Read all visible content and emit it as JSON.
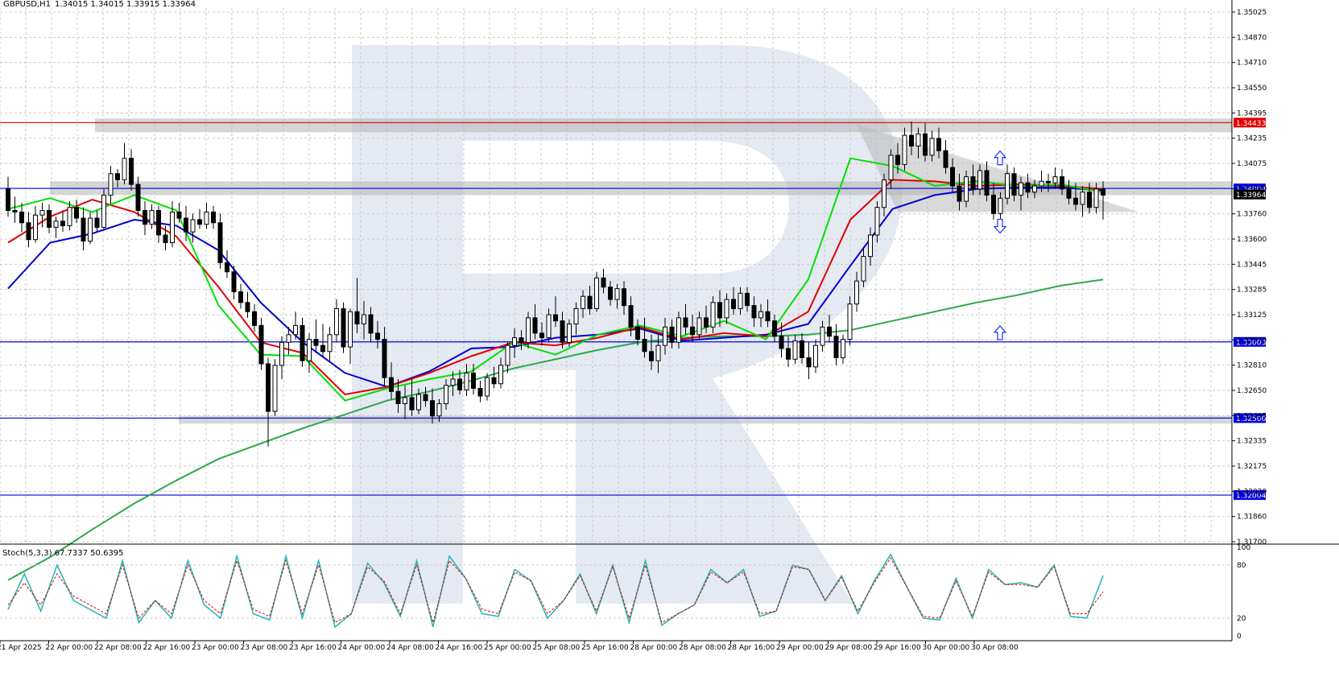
{
  "header": {
    "symbol": "GBPUSD,H1",
    "ohlc": "1.34015 1.34015 1.33915 1.33964"
  },
  "watermark": {
    "letter": "R",
    "color": "#e5e9f2"
  },
  "colors": {
    "grid": "#c8c8c8",
    "ma_fast": "#00e000",
    "ma_mid": "#e00000",
    "ma_slow": "#0000d0",
    "ma_long": "#2aa84a",
    "resistance": "#e00000",
    "support": "#0000e0",
    "zone": "#b4b4b4",
    "arrow": "#2a3fe8",
    "stoch_main": "#22b5b5",
    "stoch_signal": "#e00000",
    "bull_candle": "#ffffff",
    "bear_candle": "#000000"
  },
  "chart_data": {
    "type": "candlestick",
    "instrument": "GBPUSD",
    "timeframe": "H1",
    "ylim": [
      1.317,
      1.3518
    ],
    "price_ticks": [
      "1.35025",
      "1.34870",
      "1.34710",
      "1.34550",
      "1.34395",
      "1.34235",
      "1.34075",
      "1.33920",
      "1.33760",
      "1.33600",
      "1.33445",
      "1.33285",
      "1.33125",
      "1.32970",
      "1.32810",
      "1.32650",
      "1.32495",
      "1.32335",
      "1.32175",
      "1.32020",
      "1.31860",
      "1.31700"
    ],
    "time_ticks": [
      "21 Apr 2025",
      "22 Apr 00:00",
      "22 Apr 08:00",
      "22 Apr 16:00",
      "23 Apr 00:00",
      "23 Apr 08:00",
      "23 Apr 16:00",
      "24 Apr 00:00",
      "24 Apr 08:00",
      "24 Apr 16:00",
      "25 Apr 00:00",
      "25 Apr 08:00",
      "25 Apr 16:00",
      "28 Apr 00:00",
      "28 Apr 08:00",
      "28 Apr 16:00",
      "29 Apr 00:00",
      "29 Apr 08:00",
      "29 Apr 16:00",
      "30 Apr 00:00",
      "30 Apr 08:00"
    ],
    "horizontal_levels": [
      {
        "label": "1.34433",
        "value": 1.34433,
        "role": "resistance"
      },
      {
        "label": "1.34004",
        "value": 1.34004,
        "role": "support"
      },
      {
        "label": "1.33003",
        "value": 1.33003,
        "role": "support"
      },
      {
        "label": "1.32506",
        "value": 1.32506,
        "role": "support"
      },
      {
        "label": "1.32004",
        "value": 1.32004,
        "role": "support"
      }
    ],
    "current_price": {
      "label": "1.33964",
      "value": 1.33964
    },
    "zones": [
      {
        "from": "22 Apr 00:00",
        "low": 1.3437,
        "high": 1.3446
      },
      {
        "from": "21 Apr 2025",
        "low": 1.3396,
        "high": 1.3405
      },
      {
        "from": "23 Apr 00:00",
        "low": 1.3247,
        "high": 1.3252
      }
    ],
    "triangle": {
      "top_start": 1.3442,
      "top_end": 1.3396,
      "bottom": 1.3385
    },
    "ma_long": [
      1.3145,
      1.316,
      1.3178,
      1.3195,
      1.321,
      1.3224,
      1.3234,
      1.3244,
      1.3253,
      1.3262,
      1.3268,
      1.3275,
      1.3283,
      1.3289,
      1.3295,
      1.33,
      1.3303,
      1.3304,
      1.3304,
      1.3305,
      1.3308,
      1.3314,
      1.332,
      1.3326,
      1.3331,
      1.3337,
      1.3341
    ],
    "series": [
      {
        "name": "MA fast",
        "values": [
          1.3387,
          1.3394,
          1.3385,
          1.3396,
          1.3386,
          1.3324,
          1.3292,
          1.3291,
          1.3262,
          1.327,
          1.3276,
          1.3281,
          1.33,
          1.3292,
          1.3305,
          1.3311,
          1.3304,
          1.3314,
          1.3302,
          1.3341,
          1.342,
          1.3415,
          1.3402,
          1.3405,
          1.3402,
          1.3403,
          1.3398
        ]
      },
      {
        "name": "MA mid",
        "values": [
          1.3365,
          1.3382,
          1.3393,
          1.3385,
          1.3369,
          1.3336,
          1.33,
          1.3293,
          1.3266,
          1.3271,
          1.328,
          1.3291,
          1.33,
          1.3298,
          1.3303,
          1.331,
          1.3302,
          1.3306,
          1.3304,
          1.332,
          1.338,
          1.3406,
          1.3405,
          1.3402,
          1.3403,
          1.3402,
          1.34
        ]
      },
      {
        "name": "MA slow",
        "values": [
          1.3335,
          1.3365,
          1.3371,
          1.338,
          1.3376,
          1.336,
          1.3326,
          1.33,
          1.328,
          1.3271,
          1.3281,
          1.3296,
          1.3297,
          1.3303,
          1.3305,
          1.3309,
          1.3301,
          1.3303,
          1.3305,
          1.3312,
          1.335,
          1.3387,
          1.3396,
          1.34,
          1.3401,
          1.3401,
          1.3399
        ]
      }
    ],
    "signal_arrows": [
      {
        "direction": "up",
        "value": 1.342
      },
      {
        "direction": "down",
        "value": 1.3376
      },
      {
        "direction": "up",
        "value": 1.3306
      }
    ],
    "indicator": {
      "label": "Stoch(5,3,3) 67.7337 50.6395",
      "ylim": [
        0,
        100
      ],
      "ticks": [
        "100",
        "80",
        "20",
        "0"
      ],
      "main": [
        30,
        70,
        28,
        80,
        40,
        30,
        20,
        85,
        15,
        40,
        20,
        85,
        35,
        20,
        90,
        25,
        18,
        90,
        20,
        85,
        10,
        25,
        82,
        60,
        22,
        85,
        10,
        90,
        65,
        25,
        22,
        75,
        62,
        20,
        40,
        70,
        25,
        80,
        15,
        85,
        12,
        25,
        35,
        75,
        60,
        75,
        22,
        28,
        80,
        75,
        40,
        68,
        25,
        62,
        92,
        55,
        20,
        18,
        65,
        20,
        75,
        58,
        60,
        55,
        80,
        22,
        20,
        68
      ],
      "signal": [
        35,
        60,
        35,
        70,
        45,
        35,
        25,
        80,
        20,
        40,
        25,
        80,
        40,
        25,
        85,
        30,
        22,
        85,
        25,
        80,
        15,
        25,
        78,
        62,
        25,
        80,
        15,
        85,
        65,
        30,
        25,
        72,
        62,
        25,
        40,
        68,
        28,
        78,
        20,
        80,
        15,
        25,
        35,
        72,
        60,
        72,
        25,
        28,
        78,
        75,
        40,
        66,
        28,
        60,
        88,
        55,
        22,
        20,
        62,
        22,
        72,
        58,
        58,
        55,
        78,
        25,
        25,
        50
      ]
    },
    "candles": [
      [
        1.34,
        1.3408,
        1.3382,
        1.3386
      ],
      [
        1.3386,
        1.3395,
        1.3378,
        1.3385
      ],
      [
        1.3385,
        1.3391,
        1.3372,
        1.3378
      ],
      [
        1.3378,
        1.3385,
        1.3362,
        1.3367
      ],
      [
        1.3367,
        1.3389,
        1.3365,
        1.3383
      ],
      [
        1.3383,
        1.3391,
        1.3375,
        1.3386
      ],
      [
        1.3386,
        1.339,
        1.3371,
        1.3375
      ],
      [
        1.3375,
        1.3382,
        1.3368,
        1.3379
      ],
      [
        1.3379,
        1.3386,
        1.3372,
        1.3376
      ],
      [
        1.3376,
        1.3392,
        1.3373,
        1.3388
      ],
      [
        1.3388,
        1.3393,
        1.3378,
        1.3381
      ],
      [
        1.3381,
        1.3388,
        1.336,
        1.3366
      ],
      [
        1.3366,
        1.3385,
        1.3364,
        1.3381
      ],
      [
        1.3381,
        1.3386,
        1.3372,
        1.3375
      ],
      [
        1.3375,
        1.34,
        1.3373,
        1.3396
      ],
      [
        1.3396,
        1.3415,
        1.339,
        1.341
      ],
      [
        1.341,
        1.3413,
        1.3401,
        1.3406
      ],
      [
        1.3406,
        1.343,
        1.3403,
        1.342
      ],
      [
        1.342,
        1.3426,
        1.3399,
        1.3403
      ],
      [
        1.3403,
        1.3408,
        1.3382,
        1.3386
      ],
      [
        1.3386,
        1.3392,
        1.337,
        1.3377
      ],
      [
        1.3377,
        1.339,
        1.3374,
        1.3386
      ],
      [
        1.3386,
        1.3389,
        1.3365,
        1.337
      ],
      [
        1.337,
        1.3376,
        1.336,
        1.3365
      ],
      [
        1.3365,
        1.3392,
        1.3362,
        1.3385
      ],
      [
        1.3385,
        1.3391,
        1.3378,
        1.3381
      ],
      [
        1.3381,
        1.3389,
        1.3366,
        1.3372
      ],
      [
        1.3372,
        1.3384,
        1.3365,
        1.338
      ],
      [
        1.338,
        1.3387,
        1.3374,
        1.3377
      ],
      [
        1.3377,
        1.3391,
        1.3374,
        1.3385
      ],
      [
        1.3385,
        1.3389,
        1.3374,
        1.3378
      ],
      [
        1.3378,
        1.3384,
        1.3348,
        1.3352
      ],
      [
        1.3352,
        1.336,
        1.3342,
        1.3346
      ],
      [
        1.3346,
        1.335,
        1.3328,
        1.3333
      ],
      [
        1.3333,
        1.3338,
        1.3322,
        1.3326
      ],
      [
        1.3326,
        1.3333,
        1.3316,
        1.332
      ],
      [
        1.332,
        1.3325,
        1.3307,
        1.3311
      ],
      [
        1.3311,
        1.3316,
        1.3282,
        1.3286
      ],
      [
        1.3286,
        1.329,
        1.3232,
        1.3255
      ],
      [
        1.3255,
        1.3289,
        1.3252,
        1.3285
      ],
      [
        1.3285,
        1.3304,
        1.3276,
        1.33
      ],
      [
        1.33,
        1.331,
        1.3292,
        1.3305
      ],
      [
        1.3305,
        1.332,
        1.3302,
        1.3311
      ],
      [
        1.3311,
        1.3316,
        1.3284,
        1.3288
      ],
      [
        1.3288,
        1.3306,
        1.328,
        1.3302
      ],
      [
        1.3302,
        1.3315,
        1.3293,
        1.3298
      ],
      [
        1.3298,
        1.3312,
        1.329,
        1.3294
      ],
      [
        1.3294,
        1.331,
        1.3288,
        1.3305
      ],
      [
        1.3305,
        1.3328,
        1.33,
        1.3322
      ],
      [
        1.3322,
        1.3326,
        1.3293,
        1.3297
      ],
      [
        1.3297,
        1.3322,
        1.3286,
        1.332
      ],
      [
        1.332,
        1.3342,
        1.3306,
        1.3312
      ],
      [
        1.3312,
        1.3327,
        1.3302,
        1.3318
      ],
      [
        1.3318,
        1.3323,
        1.33,
        1.3306
      ],
      [
        1.3306,
        1.3314,
        1.3296,
        1.3302
      ],
      [
        1.3302,
        1.331,
        1.3272,
        1.3277
      ],
      [
        1.3277,
        1.3287,
        1.3263,
        1.3268
      ],
      [
        1.3268,
        1.3276,
        1.3254,
        1.326
      ],
      [
        1.326,
        1.3272,
        1.325,
        1.3264
      ],
      [
        1.3264,
        1.3276,
        1.3252,
        1.3256
      ],
      [
        1.3256,
        1.327,
        1.3253,
        1.3266
      ],
      [
        1.3266,
        1.3271,
        1.3258,
        1.3262
      ],
      [
        1.3262,
        1.327,
        1.3247,
        1.3252
      ],
      [
        1.3252,
        1.3263,
        1.3248,
        1.326
      ],
      [
        1.326,
        1.3276,
        1.3256,
        1.3272
      ],
      [
        1.3272,
        1.3281,
        1.3265,
        1.3276
      ],
      [
        1.3276,
        1.3282,
        1.3266,
        1.3269
      ],
      [
        1.3269,
        1.3286,
        1.3265,
        1.328
      ],
      [
        1.328,
        1.3286,
        1.3266,
        1.327
      ],
      [
        1.327,
        1.3275,
        1.3261,
        1.3265
      ],
      [
        1.3265,
        1.328,
        1.3262,
        1.3277
      ],
      [
        1.3277,
        1.3284,
        1.327,
        1.3273
      ],
      [
        1.3273,
        1.329,
        1.327,
        1.3285
      ],
      [
        1.3285,
        1.33,
        1.328,
        1.3298
      ],
      [
        1.3298,
        1.3309,
        1.329,
        1.3303
      ],
      [
        1.3303,
        1.3308,
        1.3295,
        1.33
      ],
      [
        1.33,
        1.332,
        1.3296,
        1.3316
      ],
      [
        1.3316,
        1.3325,
        1.3302,
        1.3306
      ],
      [
        1.3306,
        1.3313,
        1.3298,
        1.3303
      ],
      [
        1.3303,
        1.3322,
        1.33,
        1.3318
      ],
      [
        1.3318,
        1.333,
        1.331,
        1.3314
      ],
      [
        1.3314,
        1.332,
        1.3296,
        1.33
      ],
      [
        1.33,
        1.3315,
        1.3297,
        1.3312
      ],
      [
        1.3312,
        1.3326,
        1.3305,
        1.3322
      ],
      [
        1.3322,
        1.3334,
        1.3316,
        1.333
      ],
      [
        1.333,
        1.3337,
        1.3318,
        1.3322
      ],
      [
        1.3322,
        1.3346,
        1.332,
        1.3342
      ],
      [
        1.3342,
        1.3348,
        1.3332,
        1.3336
      ],
      [
        1.3336,
        1.334,
        1.3324,
        1.3328
      ],
      [
        1.3328,
        1.3338,
        1.3322,
        1.3335
      ],
      [
        1.3335,
        1.334,
        1.3318,
        1.3324
      ],
      [
        1.3324,
        1.333,
        1.3304,
        1.331
      ],
      [
        1.331,
        1.3315,
        1.3298,
        1.3302
      ],
      [
        1.3302,
        1.3316,
        1.329,
        1.3294
      ],
      [
        1.3294,
        1.3305,
        1.3282,
        1.3288
      ],
      [
        1.3288,
        1.3305,
        1.328,
        1.3298
      ],
      [
        1.3298,
        1.3316,
        1.3292,
        1.331
      ],
      [
        1.331,
        1.3315,
        1.3296,
        1.33
      ],
      [
        1.33,
        1.332,
        1.3296,
        1.3316
      ],
      [
        1.3316,
        1.3325,
        1.3305,
        1.331
      ],
      [
        1.331,
        1.3318,
        1.33,
        1.3305
      ],
      [
        1.3305,
        1.332,
        1.3302,
        1.3316
      ],
      [
        1.3316,
        1.3324,
        1.3306,
        1.331
      ],
      [
        1.331,
        1.333,
        1.3306,
        1.3326
      ],
      [
        1.3326,
        1.3334,
        1.331,
        1.3316
      ],
      [
        1.3316,
        1.3332,
        1.3312,
        1.3328
      ],
      [
        1.3328,
        1.3336,
        1.3318,
        1.3322
      ],
      [
        1.3322,
        1.3336,
        1.3318,
        1.3332
      ],
      [
        1.3332,
        1.3336,
        1.332,
        1.3324
      ],
      [
        1.3324,
        1.333,
        1.331,
        1.3316
      ],
      [
        1.3316,
        1.3325,
        1.331,
        1.332
      ],
      [
        1.332,
        1.3328,
        1.331,
        1.3314
      ],
      [
        1.3314,
        1.3318,
        1.33,
        1.3304
      ],
      [
        1.3304,
        1.3313,
        1.329,
        1.3296
      ],
      [
        1.3296,
        1.3304,
        1.3284,
        1.3289
      ],
      [
        1.3289,
        1.3305,
        1.3286,
        1.3301
      ],
      [
        1.3301,
        1.3306,
        1.3286,
        1.329
      ],
      [
        1.329,
        1.33,
        1.3276,
        1.3284
      ],
      [
        1.3284,
        1.3302,
        1.328,
        1.3298
      ],
      [
        1.3298,
        1.3314,
        1.3294,
        1.331
      ],
      [
        1.331,
        1.3318,
        1.33,
        1.3304
      ],
      [
        1.3304,
        1.3312,
        1.3285,
        1.329
      ],
      [
        1.329,
        1.3305,
        1.3286,
        1.3302
      ],
      [
        1.3302,
        1.333,
        1.3298,
        1.3325
      ],
      [
        1.3325,
        1.3346,
        1.332,
        1.334
      ],
      [
        1.334,
        1.3362,
        1.3336,
        1.3356
      ],
      [
        1.3356,
        1.3375,
        1.335,
        1.337
      ],
      [
        1.337,
        1.3392,
        1.3365,
        1.3388
      ],
      [
        1.3388,
        1.341,
        1.3382,
        1.3406
      ],
      [
        1.3406,
        1.3426,
        1.34,
        1.3422
      ],
      [
        1.3422,
        1.343,
        1.341,
        1.3416
      ],
      [
        1.3416,
        1.344,
        1.3412,
        1.3435
      ],
      [
        1.3435,
        1.3444,
        1.3422,
        1.3428
      ],
      [
        1.3428,
        1.344,
        1.342,
        1.3436
      ],
      [
        1.3436,
        1.3443,
        1.3418,
        1.3422
      ],
      [
        1.3422,
        1.3438,
        1.3418,
        1.3433
      ],
      [
        1.3433,
        1.344,
        1.342,
        1.3425
      ],
      [
        1.3425,
        1.3432,
        1.341,
        1.3414
      ],
      [
        1.3414,
        1.342,
        1.3398,
        1.3402
      ],
      [
        1.3402,
        1.341,
        1.3386,
        1.3392
      ],
      [
        1.3392,
        1.3412,
        1.3388,
        1.3408
      ],
      [
        1.3408,
        1.3416,
        1.3396,
        1.34
      ],
      [
        1.34,
        1.3416,
        1.3396,
        1.3412
      ],
      [
        1.3412,
        1.3418,
        1.3392,
        1.3396
      ],
      [
        1.3396,
        1.3404,
        1.338,
        1.3384
      ],
      [
        1.3384,
        1.3398,
        1.338,
        1.3394
      ],
      [
        1.3394,
        1.3416,
        1.339,
        1.341
      ],
      [
        1.341,
        1.3414,
        1.3392,
        1.3396
      ],
      [
        1.3396,
        1.3408,
        1.3386,
        1.3404
      ],
      [
        1.3404,
        1.341,
        1.3394,
        1.3398
      ],
      [
        1.3398,
        1.3406,
        1.3394,
        1.3402
      ],
      [
        1.3402,
        1.3412,
        1.3398,
        1.3405
      ],
      [
        1.3405,
        1.341,
        1.3398,
        1.3404
      ],
      [
        1.3404,
        1.3414,
        1.34,
        1.3408
      ],
      [
        1.3408,
        1.3413,
        1.3396,
        1.34
      ],
      [
        1.34,
        1.3406,
        1.339,
        1.3394
      ],
      [
        1.3394,
        1.3404,
        1.3386,
        1.339
      ],
      [
        1.339,
        1.3402,
        1.3382,
        1.3398
      ],
      [
        1.3398,
        1.3404,
        1.3384,
        1.3388
      ],
      [
        1.3388,
        1.3404,
        1.3384,
        1.34
      ],
      [
        1.34,
        1.3405,
        1.338,
        1.3396
      ]
    ]
  }
}
